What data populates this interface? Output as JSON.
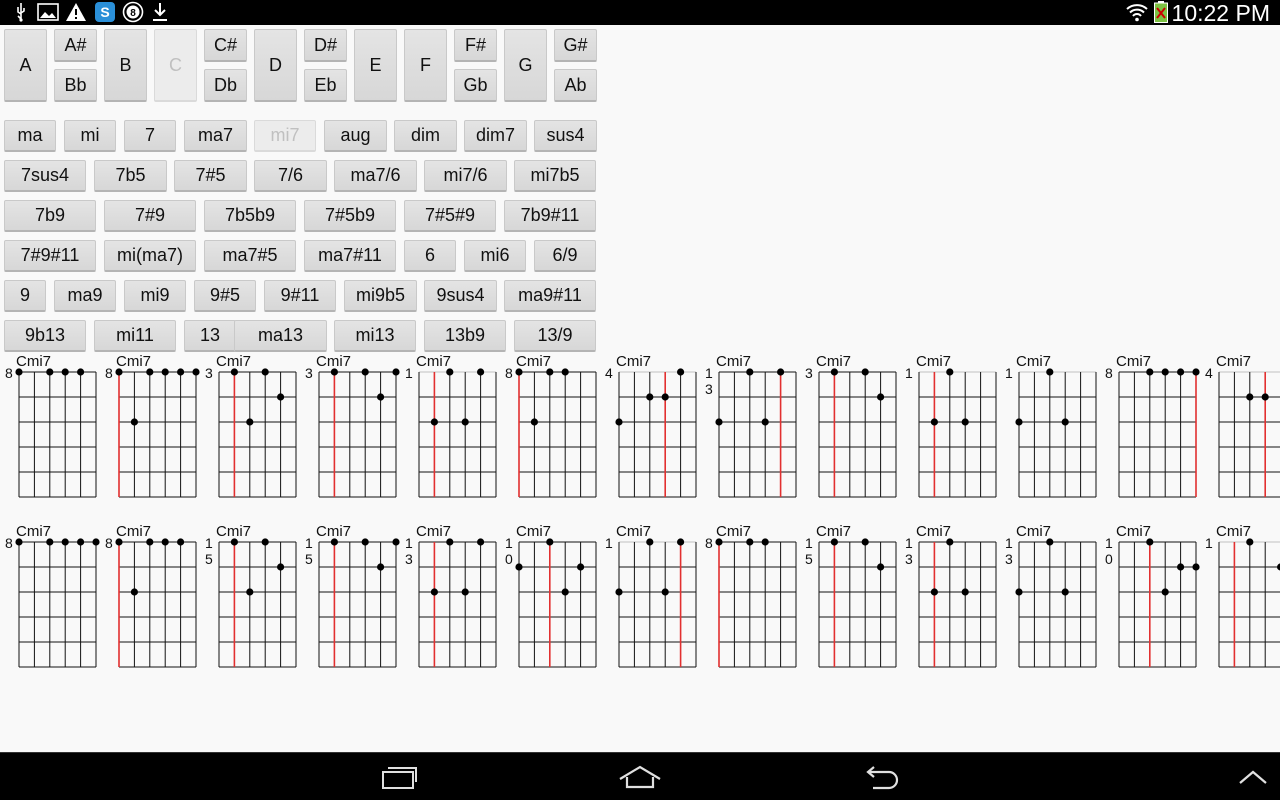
{
  "status_bar": {
    "time": "10:22 PM",
    "left_icons": [
      "usb-icon",
      "image-icon",
      "warning-icon",
      "app-s-icon",
      "circle-8-icon",
      "download-icon"
    ],
    "right_icons": [
      "wifi-icon",
      "battery-icon"
    ]
  },
  "roots": [
    "A",
    "A#",
    "Bb",
    "B",
    "C",
    "C#",
    "Db",
    "D",
    "D#",
    "Eb",
    "E",
    "F",
    "F#",
    "Gb",
    "G",
    "G#",
    "Ab"
  ],
  "selected_root": "C",
  "chord_types": [
    [
      "ma",
      "mi",
      "7",
      "ma7",
      "mi7",
      "aug",
      "dim",
      "dim7",
      "sus4"
    ],
    [
      "7sus4",
      "7b5",
      "7#5",
      "7/6",
      "ma7/6",
      "mi7/6",
      "mi7b5"
    ],
    [
      "7b9",
      "7#9",
      "7b5b9",
      "7#5b9",
      "7#5#9",
      "7b9#11"
    ],
    [
      "7#9#11",
      "mi(ma7)",
      "ma7#5",
      "ma7#11",
      "6",
      "mi6",
      "6/9"
    ],
    [
      "9",
      "ma9",
      "mi9",
      "9#5",
      "9#11",
      "mi9b5",
      "9sus4",
      "ma9#11"
    ],
    [
      "9b13",
      "mi11",
      "13",
      "ma13",
      "mi13",
      "13b9",
      "13/9"
    ]
  ],
  "selected_type": "mi7",
  "diagrams": {
    "row1": [
      {
        "name": "Cmi7",
        "fret": "8",
        "red": null,
        "open": false,
        "dots": [
          [
            0,
            0
          ],
          [
            2,
            0
          ],
          [
            3,
            0
          ],
          [
            4,
            0
          ]
        ]
      },
      {
        "name": "Cmi7",
        "fret": "8",
        "red": 0,
        "open": false,
        "dots": [
          [
            0,
            0
          ],
          [
            1,
            2
          ],
          [
            2,
            0
          ],
          [
            3,
            0
          ],
          [
            4,
            0
          ],
          [
            5,
            0
          ]
        ]
      },
      {
        "name": "Cmi7",
        "fret": "3",
        "red": 1,
        "open": false,
        "dots": [
          [
            1,
            0
          ],
          [
            2,
            2
          ],
          [
            3,
            0
          ],
          [
            4,
            1
          ]
        ]
      },
      {
        "name": "Cmi7",
        "fret": "3",
        "red": 1,
        "open": false,
        "dots": [
          [
            1,
            0
          ],
          [
            3,
            0
          ],
          [
            4,
            1
          ],
          [
            5,
            0
          ]
        ]
      },
      {
        "name": "Cmi7",
        "fret": "1",
        "red": 1,
        "open": true,
        "dots": [
          [
            1,
            2
          ],
          [
            2,
            0
          ],
          [
            3,
            2
          ],
          [
            4,
            0
          ]
        ]
      },
      {
        "name": "Cmi7",
        "fret": "8",
        "red": 0,
        "open": false,
        "dots": [
          [
            0,
            0
          ],
          [
            1,
            2
          ],
          [
            2,
            0
          ],
          [
            3,
            0
          ]
        ]
      },
      {
        "name": "Cmi7",
        "fret": "4",
        "red": 3,
        "open": true,
        "dots": [
          [
            0,
            2
          ],
          [
            2,
            1
          ],
          [
            3,
            1
          ],
          [
            4,
            0
          ]
        ]
      },
      {
        "name": "Cmi7",
        "fret": "13",
        "red": 4,
        "open": false,
        "dots": [
          [
            0,
            2
          ],
          [
            2,
            0
          ],
          [
            3,
            2
          ],
          [
            4,
            0
          ]
        ]
      },
      {
        "name": "Cmi7",
        "fret": "3",
        "red": 1,
        "open": false,
        "dots": [
          [
            1,
            0
          ],
          [
            3,
            0
          ],
          [
            4,
            1
          ]
        ]
      },
      {
        "name": "Cmi7",
        "fret": "1",
        "red": 1,
        "open": true,
        "dots": [
          [
            1,
            2
          ],
          [
            2,
            0
          ],
          [
            3,
            2
          ]
        ]
      },
      {
        "name": "Cmi7",
        "fret": "1",
        "red": null,
        "open": true,
        "dots": [
          [
            0,
            2
          ],
          [
            2,
            0
          ],
          [
            3,
            2
          ]
        ]
      },
      {
        "name": "Cmi7",
        "fret": "8",
        "red": 5,
        "open": false,
        "dots": [
          [
            2,
            0
          ],
          [
            3,
            0
          ],
          [
            4,
            0
          ],
          [
            5,
            0
          ]
        ]
      },
      {
        "name": "Cmi7",
        "fret": "4",
        "red": 3,
        "open": true,
        "dots": [
          [
            2,
            1
          ],
          [
            3,
            1
          ]
        ]
      }
    ],
    "row2": [
      {
        "name": "Cmi7",
        "fret": "8",
        "red": null,
        "open": false,
        "dots": [
          [
            0,
            0
          ],
          [
            2,
            0
          ],
          [
            3,
            0
          ],
          [
            4,
            0
          ],
          [
            5,
            0
          ]
        ]
      },
      {
        "name": "Cmi7",
        "fret": "8",
        "red": 0,
        "open": false,
        "dots": [
          [
            0,
            0
          ],
          [
            1,
            2
          ],
          [
            2,
            0
          ],
          [
            3,
            0
          ],
          [
            4,
            0
          ]
        ]
      },
      {
        "name": "Cmi7",
        "fret": "15",
        "red": 1,
        "open": false,
        "dots": [
          [
            1,
            0
          ],
          [
            2,
            2
          ],
          [
            3,
            0
          ],
          [
            4,
            1
          ]
        ]
      },
      {
        "name": "Cmi7",
        "fret": "15",
        "red": 1,
        "open": false,
        "dots": [
          [
            1,
            0
          ],
          [
            3,
            0
          ],
          [
            4,
            1
          ],
          [
            5,
            0
          ]
        ]
      },
      {
        "name": "Cmi7",
        "fret": "13",
        "red": 1,
        "open": false,
        "dots": [
          [
            1,
            2
          ],
          [
            2,
            0
          ],
          [
            3,
            2
          ],
          [
            4,
            0
          ]
        ]
      },
      {
        "name": "Cmi7",
        "fret": "10",
        "red": 2,
        "open": false,
        "dots": [
          [
            0,
            1
          ],
          [
            2,
            0
          ],
          [
            3,
            2
          ],
          [
            4,
            1
          ]
        ]
      },
      {
        "name": "Cmi7",
        "fret": "1",
        "red": 4,
        "open": true,
        "dots": [
          [
            0,
            2
          ],
          [
            2,
            0
          ],
          [
            3,
            2
          ],
          [
            4,
            0
          ]
        ]
      },
      {
        "name": "Cmi7",
        "fret": "8",
        "red": 0,
        "open": false,
        "dots": [
          [
            0,
            0
          ],
          [
            2,
            0
          ],
          [
            3,
            0
          ]
        ]
      },
      {
        "name": "Cmi7",
        "fret": "15",
        "red": 1,
        "open": false,
        "dots": [
          [
            1,
            0
          ],
          [
            3,
            0
          ],
          [
            4,
            1
          ]
        ]
      },
      {
        "name": "Cmi7",
        "fret": "13",
        "red": 1,
        "open": false,
        "dots": [
          [
            1,
            2
          ],
          [
            2,
            0
          ],
          [
            3,
            2
          ]
        ]
      },
      {
        "name": "Cmi7",
        "fret": "13",
        "red": null,
        "open": false,
        "dots": [
          [
            0,
            2
          ],
          [
            2,
            0
          ],
          [
            3,
            2
          ]
        ]
      },
      {
        "name": "Cmi7",
        "fret": "10",
        "red": 2,
        "open": false,
        "dots": [
          [
            2,
            0
          ],
          [
            3,
            2
          ],
          [
            4,
            1
          ],
          [
            5,
            1
          ]
        ]
      },
      {
        "name": "Cmi7",
        "fret": "1",
        "red": 1,
        "open": true,
        "dots": [
          [
            2,
            0
          ],
          [
            4,
            1
          ]
        ]
      }
    ]
  },
  "nav": [
    "recent-apps-icon",
    "home-icon",
    "back-icon",
    "up-chevron-icon"
  ]
}
